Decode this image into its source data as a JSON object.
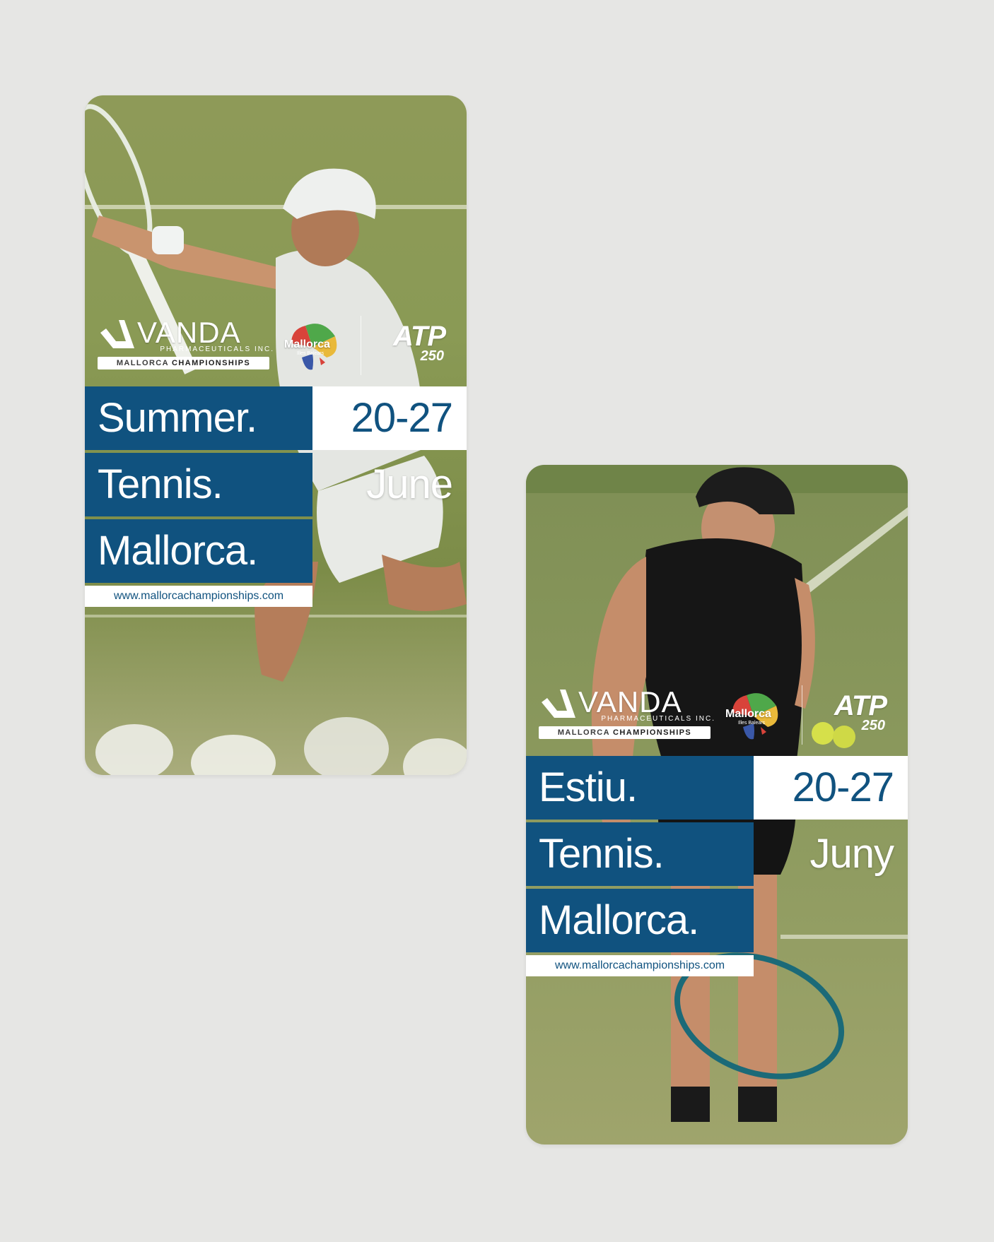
{
  "colors": {
    "background": "#e6e6e4",
    "brand_blue": "#10527f",
    "white": "#ffffff"
  },
  "cards": [
    {
      "logo": {
        "vanda_word": "VANDA",
        "vanda_sub": "PHARMACEUTICALS INC.",
        "champ_a": "MALLORCA",
        "champ_b": " CHAMPIONSHIPS",
        "mallorca": "Mallorca",
        "mallorca_sub": "Illes Balears",
        "atp": "ATP",
        "atp_num": "250"
      },
      "lines": [
        "Summer.",
        "Tennis.",
        "Mallorca."
      ],
      "dates": "20-27",
      "month": "June",
      "url": "www.mallorcachampionships.com"
    },
    {
      "logo": {
        "vanda_word": "VANDA",
        "vanda_sub": "PHARMACEUTICALS INC.",
        "champ_a": "MALLORCA",
        "champ_b": " CHAMPIONSHIPS",
        "mallorca": "Mallorca",
        "mallorca_sub": "Illes Balears",
        "atp": "ATP",
        "atp_num": "250"
      },
      "lines": [
        "Estiu.",
        "Tennis.",
        "Mallorca."
      ],
      "dates": "20-27",
      "month": "Juny",
      "url": "www.mallorcachampionships.com"
    }
  ]
}
